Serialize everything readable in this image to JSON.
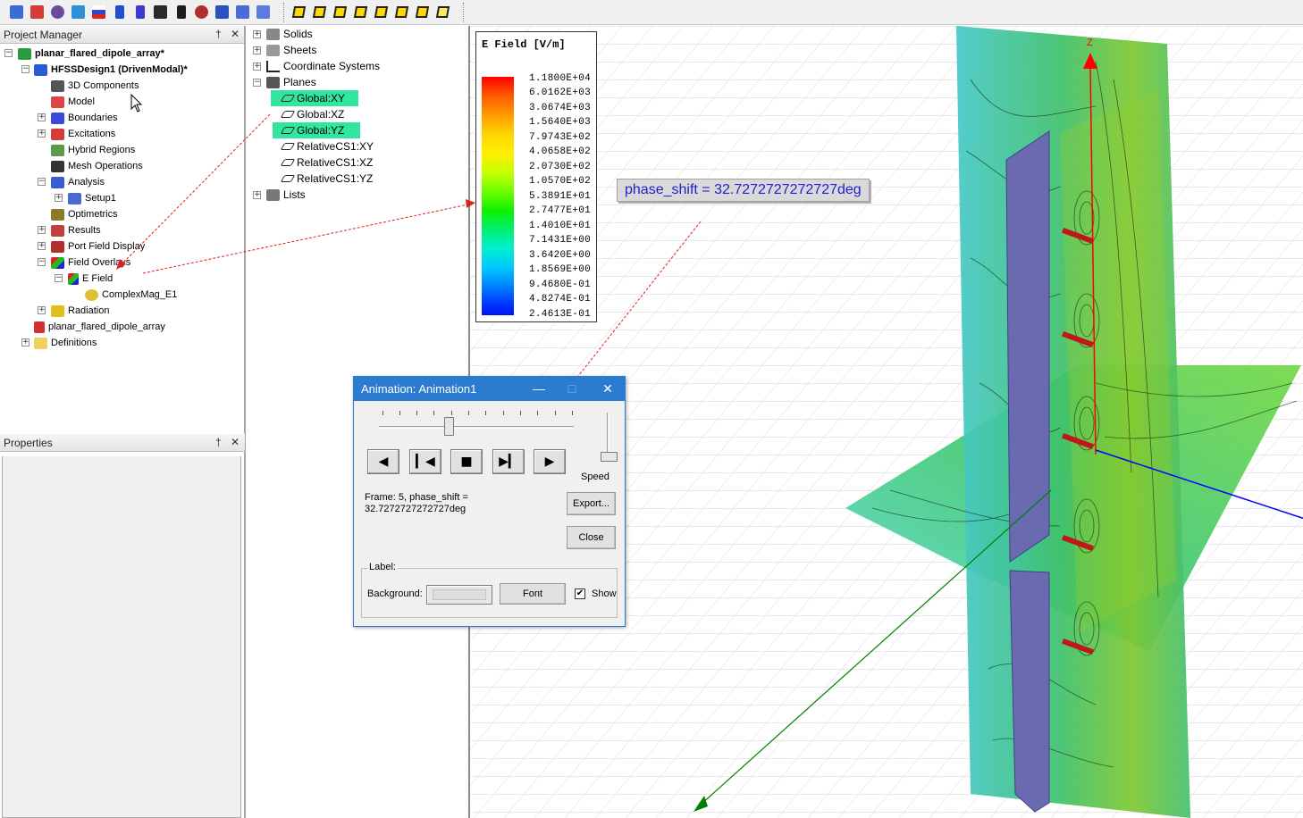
{
  "toolbar": {
    "group1_icons": [
      "box-array-icon",
      "excitation-icon",
      "radiation-icon",
      "analysis-icon",
      "mesh-icon",
      "port-icon",
      "hybrid-icon",
      "solve-icon",
      "grid-icon",
      "field-icon",
      "plot-icon",
      "overlay-icon"
    ],
    "group2_icons": [
      "box-view-1-icon",
      "box-view-2-icon",
      "box-view-3-icon",
      "box-view-4-icon",
      "box-view-5-icon",
      "box-view-6-icon",
      "box-view-7-icon",
      "box-view-8-icon"
    ]
  },
  "project_manager": {
    "title": "Project Manager",
    "pin": "†",
    "close": "✕",
    "items": [
      {
        "label": "planar_flared_dipole_array*"
      },
      {
        "label": "HFSSDesign1 (DrivenModal)*"
      },
      {
        "label": "3D Components"
      },
      {
        "label": "Model"
      },
      {
        "label": "Boundaries"
      },
      {
        "label": "Excitations"
      },
      {
        "label": "Hybrid Regions"
      },
      {
        "label": "Mesh Operations"
      },
      {
        "label": "Analysis"
      },
      {
        "label": "Setup1"
      },
      {
        "label": "Optimetrics"
      },
      {
        "label": "Results"
      },
      {
        "label": "Port Field Display"
      },
      {
        "label": "Field Overlays"
      },
      {
        "label": "E Field"
      },
      {
        "label": "ComplexMag_E1"
      },
      {
        "label": "Radiation"
      },
      {
        "label": "planar_flared_dipole_array"
      },
      {
        "label": "Definitions"
      }
    ]
  },
  "properties": {
    "title": "Properties",
    "pin": "†",
    "close": "✕"
  },
  "model_tree": {
    "items": [
      {
        "label": "Solids"
      },
      {
        "label": "Sheets"
      },
      {
        "label": "Coordinate Systems"
      },
      {
        "label": "Planes"
      },
      {
        "label": "Global:XY"
      },
      {
        "label": "Global:XZ"
      },
      {
        "label": "Global:YZ"
      },
      {
        "label": "RelativeCS1:XY"
      },
      {
        "label": "RelativeCS1:XZ"
      },
      {
        "label": "RelativeCS1:YZ"
      },
      {
        "label": "Lists"
      }
    ]
  },
  "legend": {
    "title": "E Field [V/m]",
    "values": [
      "1.1800E+04",
      "6.0162E+03",
      "3.0674E+03",
      "1.5640E+03",
      "7.9743E+02",
      "4.0658E+02",
      "2.0730E+02",
      "1.0570E+02",
      "5.3891E+01",
      "2.7477E+01",
      "1.4010E+01",
      "7.1431E+00",
      "3.6420E+00",
      "1.8569E+00",
      "9.4680E-01",
      "4.8274E-01",
      "2.4613E-01"
    ]
  },
  "view": {
    "phase_label": "phase_shift = 32.7272727272727deg",
    "axis_z": "Z",
    "colors": {
      "z_axis": "#ff0000",
      "x_axis": "#0000ff",
      "y_axis": "#008000"
    }
  },
  "animation_dialog": {
    "title": "Animation: Animation1",
    "minimize": "—",
    "maximize": "□",
    "close": "✕",
    "slider_position": 0.36,
    "speed_position": 0.95,
    "play_buttons": {
      "back": "◀",
      "step_back": "▎◀",
      "stop": "■",
      "step_forward": "▶▎",
      "forward": "▶"
    },
    "speed_label": "Speed",
    "frame_line1": "Frame: 5, phase_shift =",
    "frame_line2": "32.7272727272727deg",
    "export_label": "Export...",
    "close_label": "Close",
    "label_group": "Label:",
    "background_label": "Background:",
    "font_label": "Font",
    "show_label": "Show",
    "show_checked": "✔"
  }
}
